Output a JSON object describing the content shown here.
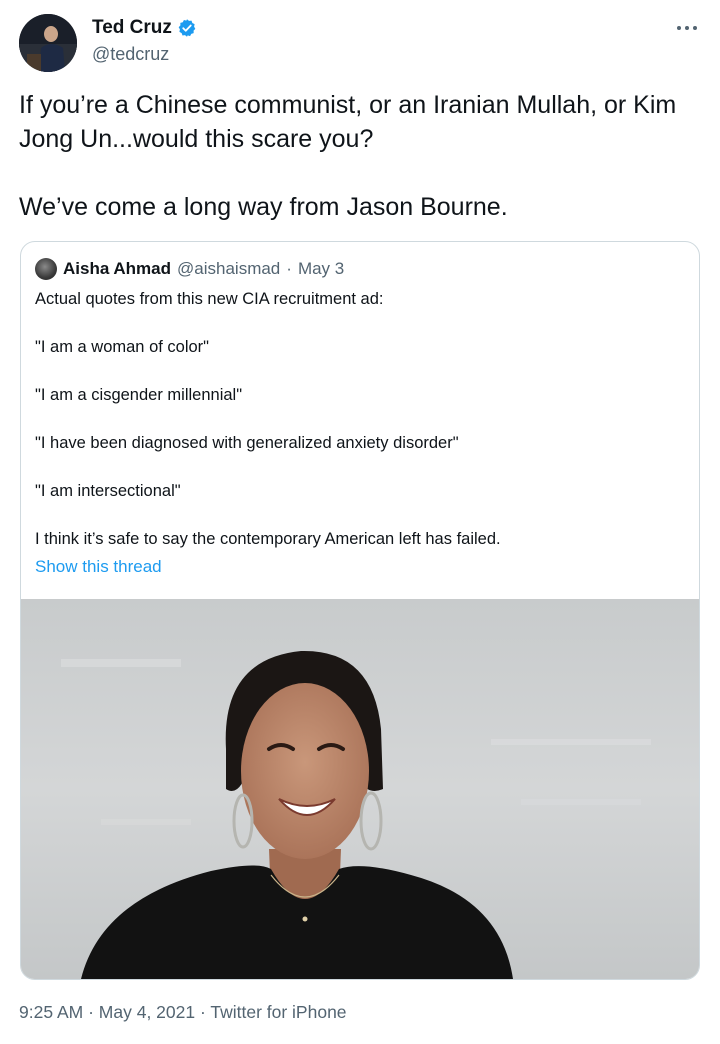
{
  "author": {
    "name": "Ted Cruz",
    "handle": "@tedcruz",
    "verified": true
  },
  "tweet": {
    "paragraphs": [
      "If you’re a Chinese communist, or an Iranian Mullah, or Kim Jong Un...would this scare you?",
      "We’ve come a long way from Jason Bourne."
    ]
  },
  "quote": {
    "name": "Aisha Ahmad",
    "handle": "@aishaismad",
    "separator": "·",
    "date": "May 3",
    "lines": [
      "Actual quotes from this new CIA recruitment ad:",
      "\"I am a woman of color\"",
      "\"I am a cisgender millennial\"",
      "\"I have been diagnosed with generalized anxiety disorder\"",
      "\"I am intersectional\"",
      "I think it’s safe to say the contemporary American left has failed."
    ],
    "show_thread": "Show this thread"
  },
  "meta": {
    "time": "9:25 AM",
    "separator": "·",
    "date": "May 4, 2021",
    "source": "Twitter for iPhone"
  },
  "icons": {
    "verified": "verified-badge-icon",
    "more": "more-icon"
  },
  "colors": {
    "link": "#1d9bf0",
    "secondary_text": "#536471",
    "border": "#cfd9de",
    "verified_badge": "#1d9bf0"
  }
}
